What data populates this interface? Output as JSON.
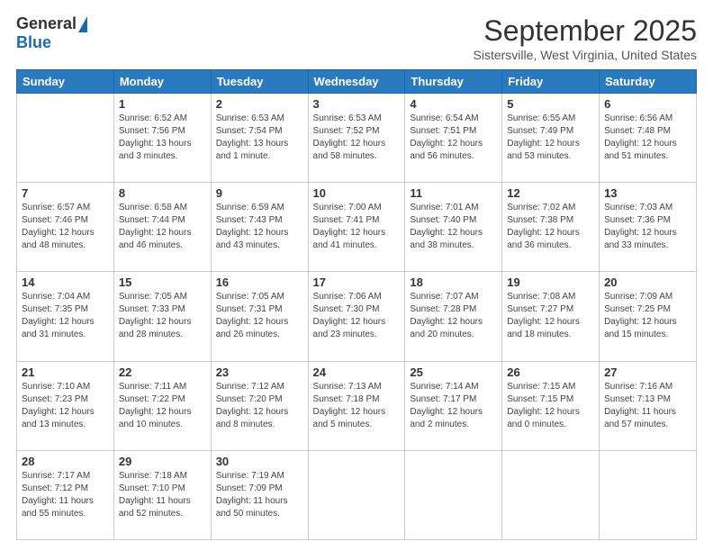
{
  "logo": {
    "general": "General",
    "blue": "Blue"
  },
  "header": {
    "month": "September 2025",
    "location": "Sistersville, West Virginia, United States"
  },
  "weekdays": [
    "Sunday",
    "Monday",
    "Tuesday",
    "Wednesday",
    "Thursday",
    "Friday",
    "Saturday"
  ],
  "weeks": [
    [
      {
        "day": "",
        "info": ""
      },
      {
        "day": "1",
        "info": "Sunrise: 6:52 AM\nSunset: 7:56 PM\nDaylight: 13 hours\nand 3 minutes."
      },
      {
        "day": "2",
        "info": "Sunrise: 6:53 AM\nSunset: 7:54 PM\nDaylight: 13 hours\nand 1 minute."
      },
      {
        "day": "3",
        "info": "Sunrise: 6:53 AM\nSunset: 7:52 PM\nDaylight: 12 hours\nand 58 minutes."
      },
      {
        "day": "4",
        "info": "Sunrise: 6:54 AM\nSunset: 7:51 PM\nDaylight: 12 hours\nand 56 minutes."
      },
      {
        "day": "5",
        "info": "Sunrise: 6:55 AM\nSunset: 7:49 PM\nDaylight: 12 hours\nand 53 minutes."
      },
      {
        "day": "6",
        "info": "Sunrise: 6:56 AM\nSunset: 7:48 PM\nDaylight: 12 hours\nand 51 minutes."
      }
    ],
    [
      {
        "day": "7",
        "info": "Sunrise: 6:57 AM\nSunset: 7:46 PM\nDaylight: 12 hours\nand 48 minutes."
      },
      {
        "day": "8",
        "info": "Sunrise: 6:58 AM\nSunset: 7:44 PM\nDaylight: 12 hours\nand 46 minutes."
      },
      {
        "day": "9",
        "info": "Sunrise: 6:59 AM\nSunset: 7:43 PM\nDaylight: 12 hours\nand 43 minutes."
      },
      {
        "day": "10",
        "info": "Sunrise: 7:00 AM\nSunset: 7:41 PM\nDaylight: 12 hours\nand 41 minutes."
      },
      {
        "day": "11",
        "info": "Sunrise: 7:01 AM\nSunset: 7:40 PM\nDaylight: 12 hours\nand 38 minutes."
      },
      {
        "day": "12",
        "info": "Sunrise: 7:02 AM\nSunset: 7:38 PM\nDaylight: 12 hours\nand 36 minutes."
      },
      {
        "day": "13",
        "info": "Sunrise: 7:03 AM\nSunset: 7:36 PM\nDaylight: 12 hours\nand 33 minutes."
      }
    ],
    [
      {
        "day": "14",
        "info": "Sunrise: 7:04 AM\nSunset: 7:35 PM\nDaylight: 12 hours\nand 31 minutes."
      },
      {
        "day": "15",
        "info": "Sunrise: 7:05 AM\nSunset: 7:33 PM\nDaylight: 12 hours\nand 28 minutes."
      },
      {
        "day": "16",
        "info": "Sunrise: 7:05 AM\nSunset: 7:31 PM\nDaylight: 12 hours\nand 26 minutes."
      },
      {
        "day": "17",
        "info": "Sunrise: 7:06 AM\nSunset: 7:30 PM\nDaylight: 12 hours\nand 23 minutes."
      },
      {
        "day": "18",
        "info": "Sunrise: 7:07 AM\nSunset: 7:28 PM\nDaylight: 12 hours\nand 20 minutes."
      },
      {
        "day": "19",
        "info": "Sunrise: 7:08 AM\nSunset: 7:27 PM\nDaylight: 12 hours\nand 18 minutes."
      },
      {
        "day": "20",
        "info": "Sunrise: 7:09 AM\nSunset: 7:25 PM\nDaylight: 12 hours\nand 15 minutes."
      }
    ],
    [
      {
        "day": "21",
        "info": "Sunrise: 7:10 AM\nSunset: 7:23 PM\nDaylight: 12 hours\nand 13 minutes."
      },
      {
        "day": "22",
        "info": "Sunrise: 7:11 AM\nSunset: 7:22 PM\nDaylight: 12 hours\nand 10 minutes."
      },
      {
        "day": "23",
        "info": "Sunrise: 7:12 AM\nSunset: 7:20 PM\nDaylight: 12 hours\nand 8 minutes."
      },
      {
        "day": "24",
        "info": "Sunrise: 7:13 AM\nSunset: 7:18 PM\nDaylight: 12 hours\nand 5 minutes."
      },
      {
        "day": "25",
        "info": "Sunrise: 7:14 AM\nSunset: 7:17 PM\nDaylight: 12 hours\nand 2 minutes."
      },
      {
        "day": "26",
        "info": "Sunrise: 7:15 AM\nSunset: 7:15 PM\nDaylight: 12 hours\nand 0 minutes."
      },
      {
        "day": "27",
        "info": "Sunrise: 7:16 AM\nSunset: 7:13 PM\nDaylight: 11 hours\nand 57 minutes."
      }
    ],
    [
      {
        "day": "28",
        "info": "Sunrise: 7:17 AM\nSunset: 7:12 PM\nDaylight: 11 hours\nand 55 minutes."
      },
      {
        "day": "29",
        "info": "Sunrise: 7:18 AM\nSunset: 7:10 PM\nDaylight: 11 hours\nand 52 minutes."
      },
      {
        "day": "30",
        "info": "Sunrise: 7:19 AM\nSunset: 7:09 PM\nDaylight: 11 hours\nand 50 minutes."
      },
      {
        "day": "",
        "info": ""
      },
      {
        "day": "",
        "info": ""
      },
      {
        "day": "",
        "info": ""
      },
      {
        "day": "",
        "info": ""
      }
    ]
  ]
}
